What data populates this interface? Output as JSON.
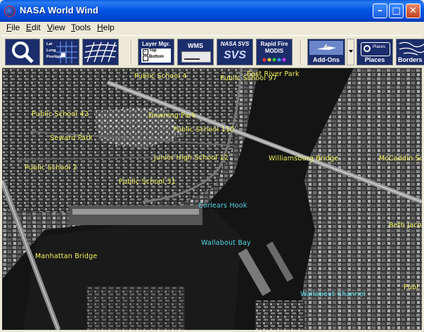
{
  "window": {
    "title": "NASA World Wind"
  },
  "titlebar_buttons": {
    "minimize_glyph": "–",
    "maximize_glyph": "□",
    "close_glyph": "✕"
  },
  "menu": {
    "items": [
      {
        "first": "F",
        "rest": "ile"
      },
      {
        "first": "E",
        "rest": "dit"
      },
      {
        "first": "V",
        "rest": "iew"
      },
      {
        "first": "T",
        "rest": "ools"
      },
      {
        "first": "H",
        "rest": "elp"
      }
    ]
  },
  "toolbar": {
    "latlong": {
      "line1": "Lat",
      "line2": "Long",
      "line3": "Position"
    },
    "layer_manager": {
      "title": "Layer Mgr.",
      "top": "Top",
      "bottom": "Bottom"
    },
    "wms": {
      "title": "WMS"
    },
    "nasa_svs": {
      "title": "NASA SVS",
      "big": "SVS"
    },
    "rapid_fire": {
      "line1": "Rapid Fire",
      "line2": "MODIS"
    },
    "addons": {
      "label": "Add-Ons"
    },
    "places": {
      "label": "Places",
      "inner": "Places"
    },
    "borders": {
      "label": "Borders"
    }
  },
  "map": {
    "labels_yellow": [
      "Public School 4",
      "Public School 97",
      "East River Park",
      "Public School 42",
      "Downing Park",
      "Public School 110",
      "Seward Park",
      "Junior High School 12",
      "Williamsburg Bridge",
      "McCaddin Sq",
      "Public School 2",
      "Public School 31",
      "Beth Jacob",
      "Manhattan Bridge",
      "Publ"
    ],
    "labels_cyan": [
      "Corlears Hook",
      "Wallabout Bay",
      "Wallabout Channel"
    ]
  },
  "colors": {
    "title_blue": "#0055E5",
    "label_yellow": "#F3F25A",
    "label_cyan": "#4FD8E8"
  }
}
